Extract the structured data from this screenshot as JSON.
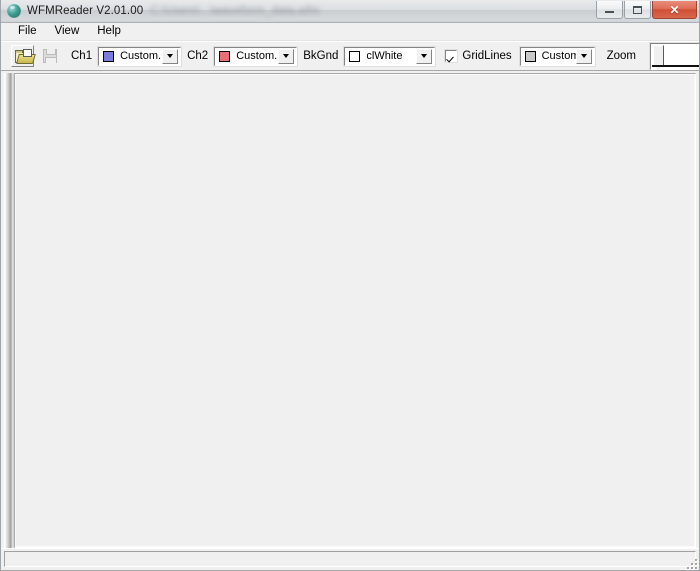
{
  "window": {
    "title": "WFMReader V2.01.00",
    "subtitle_redacted": "C:\\Users\\...\\waveform_data.wfm",
    "app_icon": "teal-sphere-icon",
    "controls": {
      "minimize_label": "Minimize",
      "maximize_label": "Maximize",
      "close_label": "✕"
    }
  },
  "menubar": {
    "items": [
      {
        "label": "File"
      },
      {
        "label": "View"
      },
      {
        "label": "Help"
      }
    ]
  },
  "toolbar": {
    "open_button": {
      "name": "open-file-button",
      "icon": "open-folder-icon",
      "enabled": true
    },
    "save_button": {
      "name": "save-file-button",
      "icon": "floppy-disk-icon",
      "enabled": false
    },
    "ch1": {
      "label": "Ch1",
      "value": "Custom...",
      "swatch": "#7b7bdd"
    },
    "ch2": {
      "label": "Ch2",
      "value": "Custom...",
      "swatch": "#ea6e76"
    },
    "bkgnd": {
      "label": "BkGnd",
      "value": "clWhite",
      "swatch": "#ffffff"
    },
    "gridlines": {
      "label": "GridLines",
      "checked": true,
      "color": {
        "value": "Custom...",
        "swatch": "#c8c8c8"
      }
    },
    "zoom": {
      "label": "Zoom",
      "value": "0",
      "min": "0",
      "max": "100"
    }
  },
  "client": {
    "plot_background": "#f0f0f0",
    "empty": true
  },
  "statusbar": {
    "text": ""
  },
  "colors": {
    "window_face": "#f0f0f0",
    "frame_border": "#9fa6ab",
    "close_button": "#cf4f36",
    "ch1_color": "#7b7bdd",
    "ch2_color": "#ea6e76"
  }
}
